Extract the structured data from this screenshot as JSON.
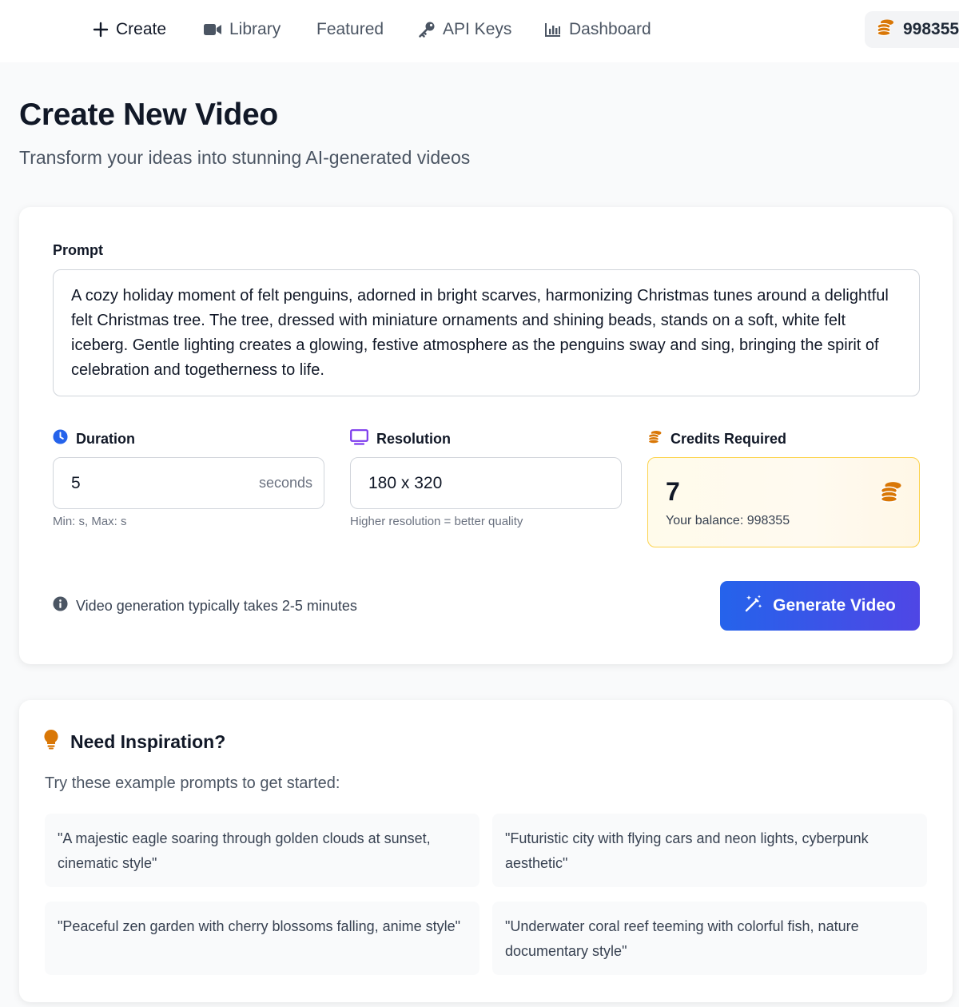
{
  "nav": {
    "items": [
      {
        "label": "Create",
        "icon": "plus-icon"
      },
      {
        "label": "Library",
        "icon": "video-camera-icon"
      },
      {
        "label": "Featured",
        "icon": ""
      },
      {
        "label": "API Keys",
        "icon": "key-icon"
      },
      {
        "label": "Dashboard",
        "icon": "chart-bar-icon"
      }
    ],
    "credits": "998355",
    "credits_icon": "coins-icon"
  },
  "header": {
    "title": "Create New Video",
    "subtitle": "Transform your ideas into stunning AI-generated videos"
  },
  "form": {
    "prompt_label": "Prompt",
    "prompt_value": "A cozy holiday moment of felt penguins, adorned in bright scarves, harmonizing Christmas tunes around a delightful felt Christmas tree. The tree, dressed with miniature ornaments and shining beads, stands on a soft, white felt iceberg. Gentle lighting creates a glowing, festive atmosphere as the penguins sway and sing, bringing the spirit of celebration and togetherness to life.",
    "duration": {
      "label": "Duration",
      "value": "5",
      "suffix": "seconds",
      "hint": "Min: s, Max: s"
    },
    "resolution": {
      "label": "Resolution",
      "value": "180 x 320",
      "hint": "Higher resolution = better quality"
    },
    "credits": {
      "label": "Credits Required",
      "value": "7",
      "balance": "Your balance: 998355"
    },
    "info": "Video generation typically takes 2-5 minutes",
    "generate_label": "Generate Video"
  },
  "inspiration": {
    "title": "Need Inspiration?",
    "subtitle": "Try these example prompts to get started:",
    "examples": [
      "\"A majestic eagle soaring through golden clouds at sunset, cinematic style\"",
      "\"Futuristic city with flying cars and neon lights, cyberpunk aesthetic\"",
      "\"Peaceful zen garden with cherry blossoms falling, anime style\"",
      "\"Underwater coral reef teeming with colorful fish, nature documentary style\""
    ]
  },
  "colors": {
    "primary": "#2563eb",
    "accent_purple": "#4f46e5",
    "coin": "#d97706",
    "clock": "#2563eb",
    "monitor": "#7c3aed",
    "bulb": "#d97706"
  }
}
